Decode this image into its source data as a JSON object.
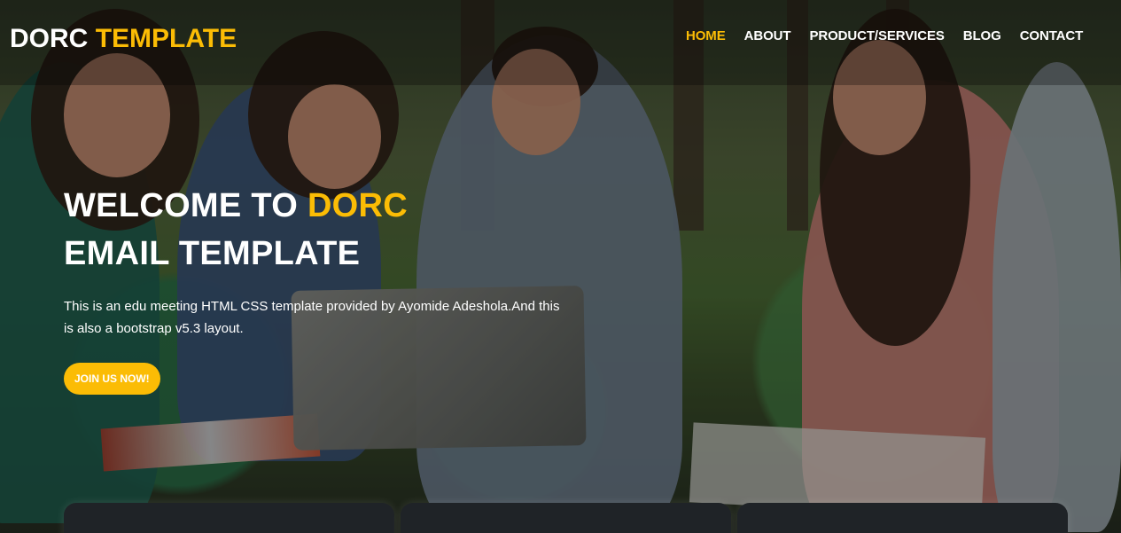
{
  "site": {
    "brand": {
      "primary": "DORC",
      "accent": "TEMPLATE"
    },
    "navigation": [
      {
        "label": "HOME",
        "active": true
      },
      {
        "label": "ABOUT",
        "active": false
      },
      {
        "label": "PRODUCT/SERVICES",
        "active": false
      },
      {
        "label": "BLOG",
        "active": false
      },
      {
        "label": "CONTACT",
        "active": false
      }
    ],
    "hero": {
      "headline_line1_before_accent": "WELCOME TO",
      "headline_accent": "DORC",
      "headline_line2": "EMAIL TEMPLATE",
      "description": "This is an edu meeting HTML CSS template provided by Ayomide Adeshola.And this is also a bootstrap v5.3 layout.",
      "button_label": "JOIN US NOW!"
    }
  },
  "colors": {
    "accent": "#fbbc05",
    "text": "#ffffff",
    "card_background": "#1f2327"
  }
}
